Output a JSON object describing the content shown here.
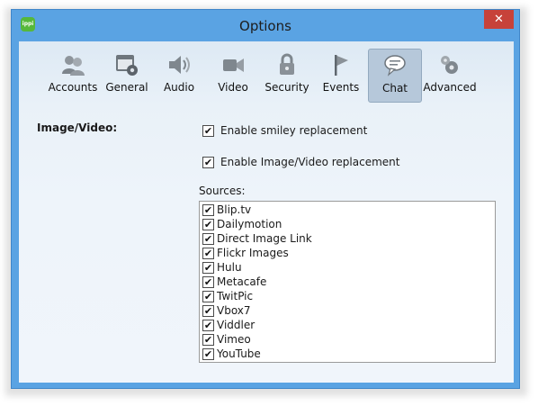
{
  "window": {
    "title": "Options",
    "app_icon_text": "ippi",
    "close_glyph": "✕"
  },
  "toolbar": {
    "tabs": [
      {
        "label": "Accounts",
        "icon": "accounts-icon",
        "active": false
      },
      {
        "label": "General",
        "icon": "general-icon",
        "active": false
      },
      {
        "label": "Audio",
        "icon": "audio-icon",
        "active": false
      },
      {
        "label": "Video",
        "icon": "video-icon",
        "active": false
      },
      {
        "label": "Security",
        "icon": "security-icon",
        "active": false
      },
      {
        "label": "Events",
        "icon": "events-icon",
        "active": false
      },
      {
        "label": "Chat",
        "icon": "chat-icon",
        "active": true
      },
      {
        "label": "Advanced",
        "icon": "advanced-icon",
        "active": false
      }
    ]
  },
  "section": {
    "label": "Image/Video:"
  },
  "options": {
    "smiley": {
      "label": "Enable smiley replacement",
      "checked": true
    },
    "image_video": {
      "label": "Enable Image/Video replacement",
      "checked": true
    }
  },
  "sources": {
    "label": "Sources:",
    "items": [
      {
        "label": "Blip.tv",
        "checked": true
      },
      {
        "label": "Dailymotion",
        "checked": true
      },
      {
        "label": "Direct Image Link",
        "checked": true
      },
      {
        "label": "Flickr Images",
        "checked": true
      },
      {
        "label": "Hulu",
        "checked": true
      },
      {
        "label": "Metacafe",
        "checked": true
      },
      {
        "label": "TwitPic",
        "checked": true
      },
      {
        "label": "Vbox7",
        "checked": true
      },
      {
        "label": "Viddler",
        "checked": true
      },
      {
        "label": "Vimeo",
        "checked": true
      },
      {
        "label": "YouTube",
        "checked": true
      }
    ]
  },
  "colors": {
    "frame": "#5aa3e3",
    "close_button": "#c7423a",
    "active_tab": "#b6c8da",
    "app_icon": "#56b83b"
  }
}
